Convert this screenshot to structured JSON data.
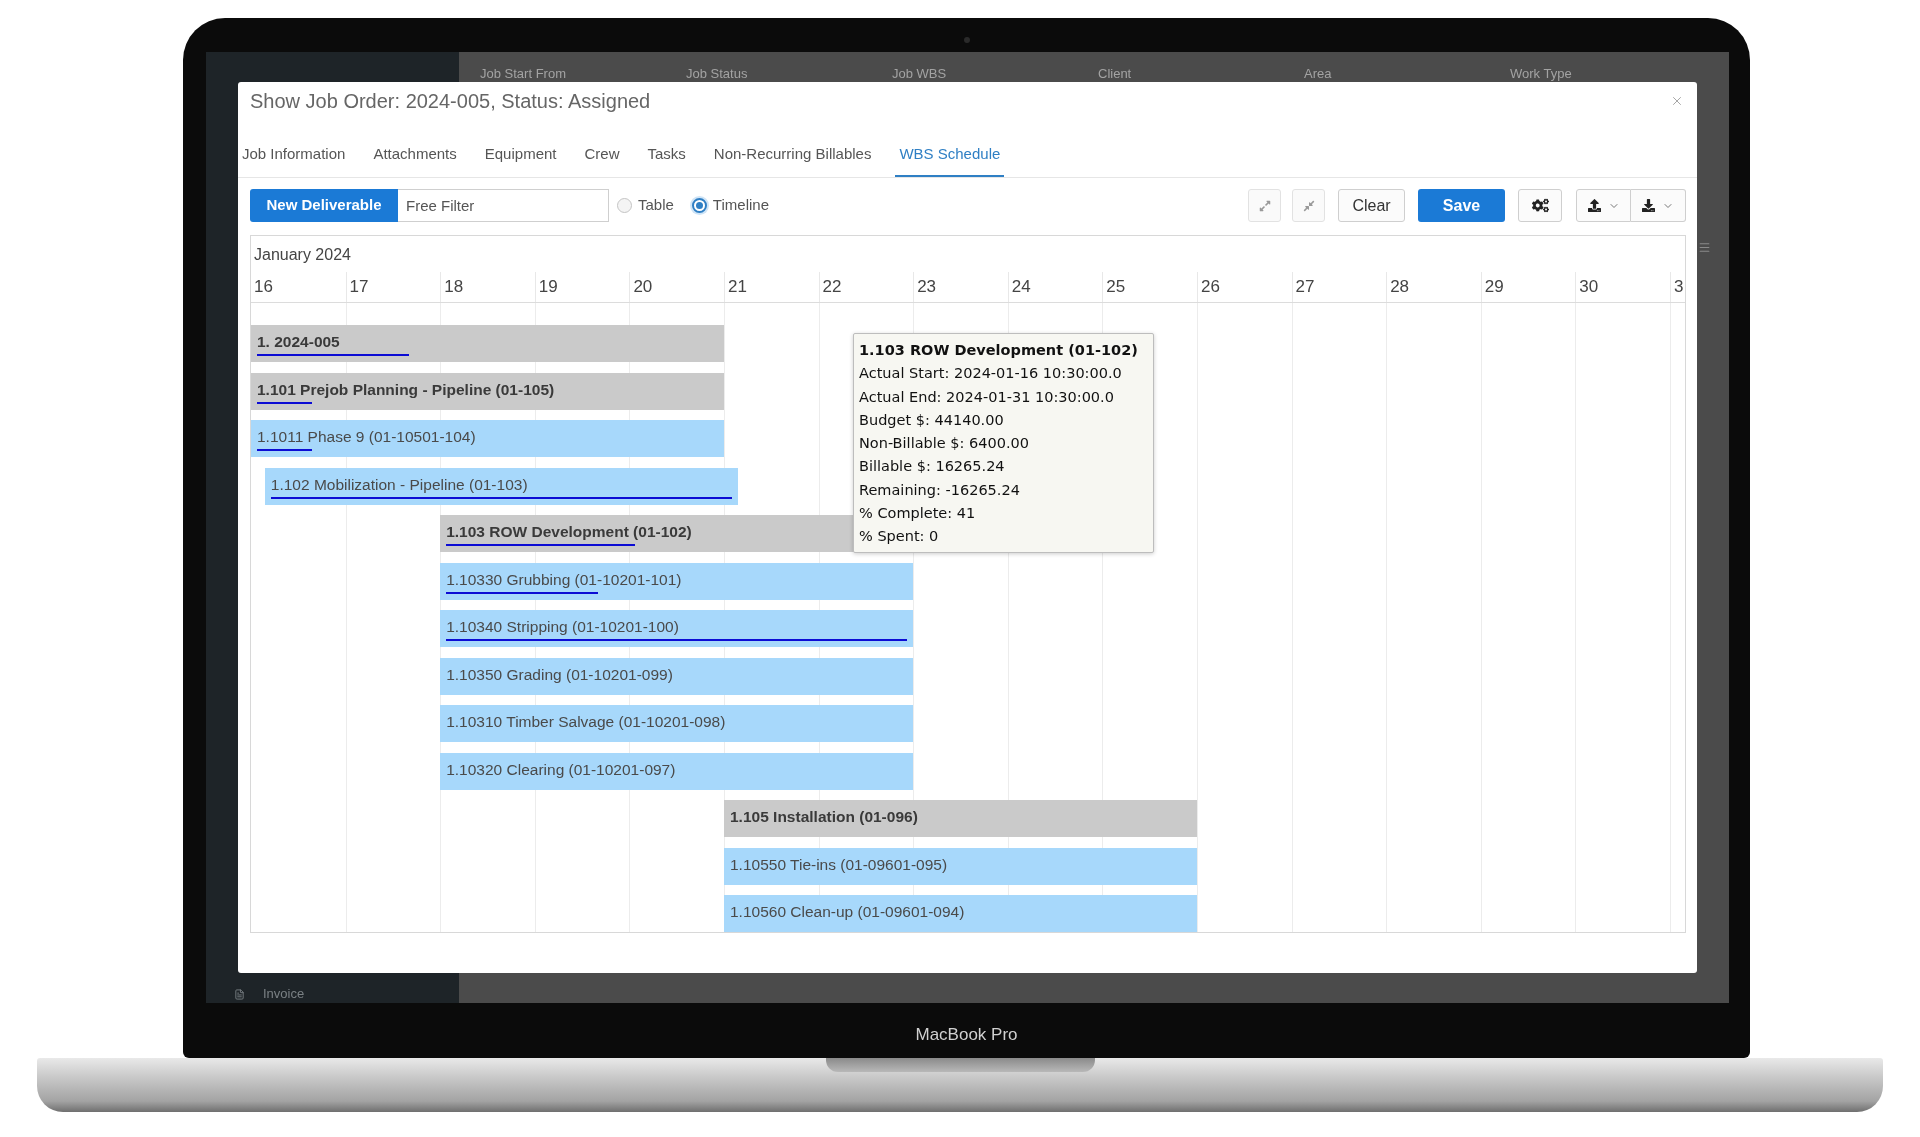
{
  "device": {
    "label": "MacBook Pro"
  },
  "background_app": {
    "columns": [
      "Job Start From",
      "Job Status",
      "Job WBS",
      "Client",
      "Area",
      "Work Type"
    ],
    "sidebar_items": [
      {
        "label": "Invoice"
      }
    ]
  },
  "dialog": {
    "title": "Show Job Order: 2024-005, Status: Assigned",
    "tabs": [
      {
        "label": "Job Information",
        "selected": false
      },
      {
        "label": "Attachments",
        "selected": false
      },
      {
        "label": "Equipment",
        "selected": false
      },
      {
        "label": "Crew",
        "selected": false
      },
      {
        "label": "Tasks",
        "selected": false
      },
      {
        "label": "Non-Recurring Billables",
        "selected": false
      },
      {
        "label": "WBS Schedule",
        "selected": true
      }
    ],
    "toolbar": {
      "new_button": "New Deliverable",
      "filter": {
        "placeholder": "Free Filter"
      },
      "view_options": [
        {
          "label": "Table",
          "selected": false
        },
        {
          "label": "Timeline",
          "selected": true
        }
      ],
      "clear_button": "Clear",
      "save_button": "Save"
    },
    "timeline": {
      "month": "January 2024",
      "days": [
        "16",
        "17",
        "18",
        "19",
        "20",
        "21",
        "22",
        "23",
        "24",
        "25",
        "26",
        "27",
        "28",
        "29",
        "30",
        "3"
      ],
      "rows": [
        {
          "kind": "group",
          "label": "1. 2024-005",
          "level": 0.33
        },
        {
          "kind": "group",
          "label": "1.101 Prejob Planning - Pipeline (01-105)",
          "level": 0.12
        },
        {
          "kind": "task",
          "label": "1.1011 Phase 9 (01-10501-104)",
          "level": 0.12
        },
        {
          "kind": "task",
          "label": "1.102 Mobilization - Pipeline (01-103)",
          "level": 1
        },
        {
          "kind": "group",
          "label": "1.103 ROW Development (01-102)",
          "level": 0.41
        },
        {
          "kind": "task",
          "label": "1.10330 Grubbing (01-10201-101)",
          "level": 0.33
        },
        {
          "kind": "task",
          "label": "1.10340 Stripping (01-10201-100)",
          "level": 1
        },
        {
          "kind": "task",
          "label": "1.10350 Grading (01-10201-099)"
        },
        {
          "kind": "task",
          "label": "1.10310 Timber Salvage (01-10201-098)"
        },
        {
          "kind": "task",
          "label": "1.10320 Clearing (01-10201-097)"
        },
        {
          "kind": "group",
          "label": "1.105 Installation (01-096)"
        },
        {
          "kind": "task",
          "label": "1.10550 Tie-ins (01-09601-095)"
        },
        {
          "kind": "task",
          "label": "1.10560 Clean-up (01-09601-094)"
        }
      ],
      "tooltip": {
        "title": "1.103 ROW Development (01-102)",
        "lines": [
          "Actual Start: 2024-01-16 10:30:00.0",
          "Actual End: 2024-01-31 10:30:00.0",
          "Budget $: 44140.00",
          "Non-Billable $: 6400.00",
          "Billable $: 16265.24",
          "Remaining: -16265.24",
          "% Complete: 41",
          "% Spent: 0"
        ]
      }
    }
  }
}
